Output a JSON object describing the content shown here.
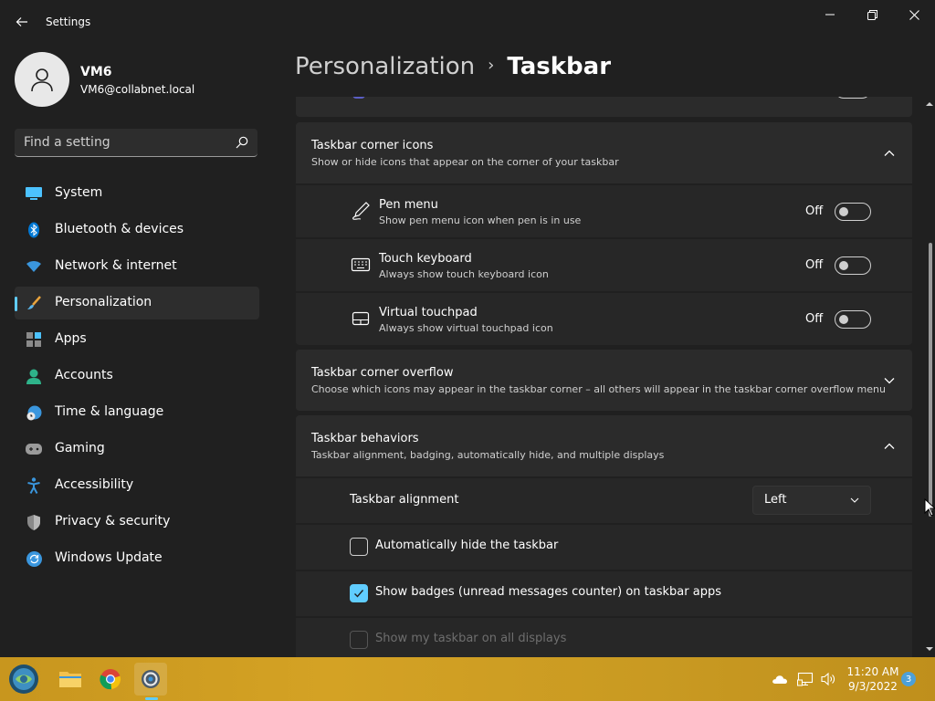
{
  "window": {
    "app_title": "Settings"
  },
  "profile": {
    "name": "VM6",
    "email": "VM6@collabnet.local"
  },
  "search": {
    "placeholder": "Find a setting"
  },
  "sidebar": {
    "items": [
      {
        "label": "System",
        "icon": "system-icon"
      },
      {
        "label": "Bluetooth & devices",
        "icon": "bluetooth-icon"
      },
      {
        "label": "Network & internet",
        "icon": "wifi-icon"
      },
      {
        "label": "Personalization",
        "icon": "brush-icon",
        "active": true
      },
      {
        "label": "Apps",
        "icon": "apps-icon"
      },
      {
        "label": "Accounts",
        "icon": "person-icon"
      },
      {
        "label": "Time & language",
        "icon": "globe-clock-icon"
      },
      {
        "label": "Gaming",
        "icon": "controller-icon"
      },
      {
        "label": "Accessibility",
        "icon": "accessibility-icon"
      },
      {
        "label": "Privacy & security",
        "icon": "shield-icon"
      },
      {
        "label": "Windows Update",
        "icon": "update-icon"
      }
    ]
  },
  "breadcrumb": {
    "parent": "Personalization",
    "separator": "›",
    "current": "Taskbar"
  },
  "corner_icons": {
    "title": "Taskbar corner icons",
    "description": "Show or hide icons that appear on the corner of your taskbar",
    "expanded": true,
    "items": [
      {
        "title": "Pen menu",
        "description": "Show pen menu icon when pen is in use",
        "state": "Off",
        "icon": "pen-icon"
      },
      {
        "title": "Touch keyboard",
        "description": "Always show touch keyboard icon",
        "state": "Off",
        "icon": "keyboard-icon"
      },
      {
        "title": "Virtual touchpad",
        "description": "Always show virtual touchpad icon",
        "state": "Off",
        "icon": "touchpad-icon"
      }
    ]
  },
  "corner_overflow": {
    "title": "Taskbar corner overflow",
    "description": "Choose which icons may appear in the taskbar corner – all others will appear in the taskbar corner overflow menu",
    "expanded": false
  },
  "behaviors": {
    "title": "Taskbar behaviors",
    "description": "Taskbar alignment, badging, automatically hide, and multiple displays",
    "expanded": true,
    "alignment_label": "Taskbar alignment",
    "alignment_value": "Left",
    "auto_hide_label": "Automatically hide the taskbar",
    "auto_hide_checked": false,
    "badges_label": "Show badges (unread messages counter) on taskbar apps",
    "badges_checked": true,
    "all_displays_label": "Show my taskbar on all displays",
    "all_displays_enabled": false
  },
  "taskbar": {
    "apps": [
      "start-orb-icon",
      "file-explorer-icon",
      "chrome-icon",
      "settings-app-icon"
    ],
    "time": "11:20 AM",
    "date": "9/3/2022",
    "notification_count": "3"
  },
  "colors": {
    "accent": "#60cdff",
    "background": "#202020",
    "card": "#2b2b2b",
    "taskbar": "#d4a224"
  }
}
